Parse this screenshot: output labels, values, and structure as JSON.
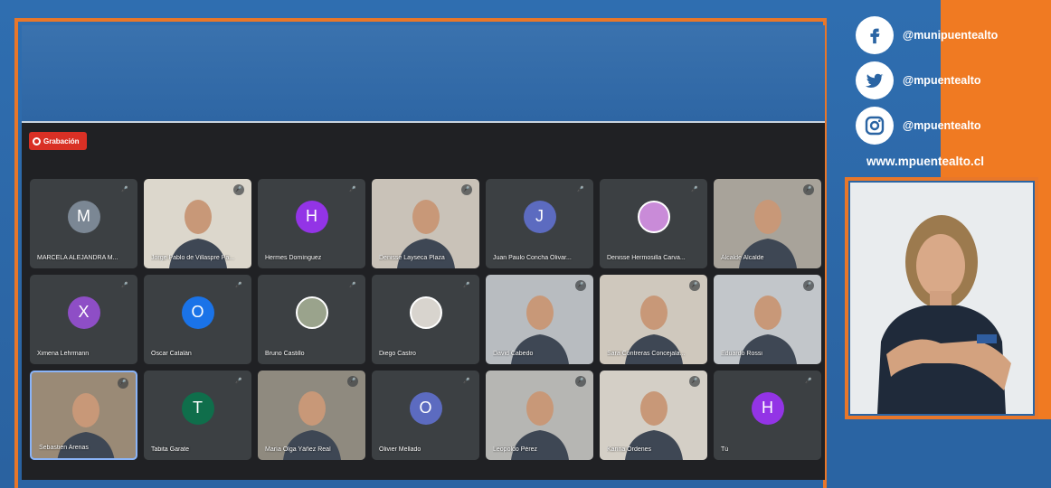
{
  "recording": {
    "label": "Grabación"
  },
  "participants": [
    {
      "name": "MARCELA ALEJANDRA M...",
      "initial": "M",
      "color": "#7b8794",
      "type": "avatar"
    },
    {
      "name": "Jorge Pablo de Villaspre Pa...",
      "type": "video",
      "bg": "#dcd7cc"
    },
    {
      "name": "Hermes Domínguez",
      "initial": "H",
      "color": "#9334e6",
      "type": "avatar"
    },
    {
      "name": "Denisse Layseca Plaza",
      "type": "video",
      "bg": "#c9c2b8"
    },
    {
      "name": "Juan Paulo Concha Olivar...",
      "initial": "J",
      "color": "#5c6bc0",
      "type": "avatar"
    },
    {
      "name": "Denisse Hermosilla Carva...",
      "type": "photo",
      "bg": "#c98bd8"
    },
    {
      "name": "Alcalde Alcalde",
      "type": "video",
      "bg": "#a8a39a"
    },
    {
      "name": "Ximena Lehrmann",
      "initial": "X",
      "color": "#8e4ec6",
      "type": "avatar"
    },
    {
      "name": "Oscar Catalán",
      "initial": "O",
      "color": "#1a73e8",
      "type": "avatar"
    },
    {
      "name": "Bruno Castillo",
      "type": "photo",
      "bg": "#9aa38c"
    },
    {
      "name": "Diego Castro",
      "type": "photo",
      "bg": "#d8d4ce"
    },
    {
      "name": "David Cabedo",
      "type": "video",
      "bg": "#b8bcc0"
    },
    {
      "name": "Sara Contreras Concejala...",
      "type": "video",
      "bg": "#cfc8bd"
    },
    {
      "name": "Eduardo Rossi",
      "type": "video",
      "bg": "#c2c6ca"
    },
    {
      "name": "Sebastien Arenas",
      "type": "video",
      "bg": "#9a8a76",
      "active": true
    },
    {
      "name": "Tabita Garate",
      "initial": "T",
      "color": "#0f6e4b",
      "type": "avatar"
    },
    {
      "name": "María Olga Yáñez Real",
      "type": "video",
      "bg": "#8f8a7f"
    },
    {
      "name": "Olivier Mellado",
      "initial": "O",
      "color": "#5c6bc0",
      "type": "avatar"
    },
    {
      "name": "Leopoldo Pérez",
      "type": "video",
      "bg": "#b6b6b3"
    },
    {
      "name": "Karina Órdenes",
      "type": "video",
      "bg": "#d4cfc6"
    },
    {
      "name": "Tú",
      "initial": "H",
      "color": "#9334e6",
      "type": "avatar"
    }
  ],
  "social": {
    "facebook": "@munipuentealto",
    "twitter": "@mpuentealto",
    "instagram": "@mpuentealto",
    "website": "www.mpuentealto.cl"
  }
}
